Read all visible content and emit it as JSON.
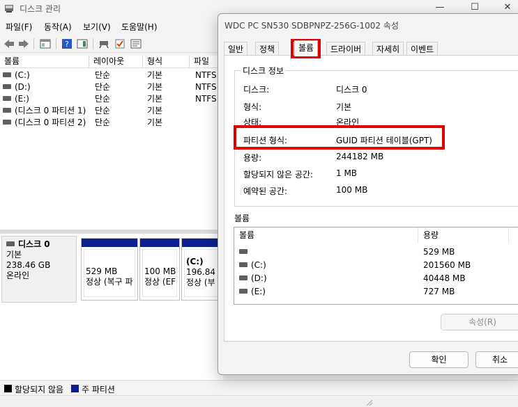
{
  "main_window": {
    "title": "디스크 관리",
    "controls": {
      "minimize": "—",
      "maximize": "☐",
      "close": "✕"
    },
    "menu": [
      "파일(F)",
      "동작(A)",
      "보기(V)",
      "도움말(H)"
    ],
    "volume_list": {
      "headers": [
        "볼륨",
        "레이아웃",
        "형식",
        "파일"
      ],
      "rows": [
        {
          "volume": "(C:)",
          "layout": "단순",
          "type": "기본",
          "fs": "NTFS"
        },
        {
          "volume": "(D:)",
          "layout": "단순",
          "type": "기본",
          "fs": "NTFS"
        },
        {
          "volume": "(E:)",
          "layout": "단순",
          "type": "기본",
          "fs": "NTFS"
        },
        {
          "volume": "(디스크 0 파티션 1)",
          "layout": "단순",
          "type": "기본",
          "fs": ""
        },
        {
          "volume": "(디스크 0 파티션 2)",
          "layout": "단순",
          "type": "기본",
          "fs": ""
        }
      ]
    },
    "disk": {
      "name": "디스크 0",
      "kind": "기본",
      "size": "238.46 GB",
      "status": "온라인",
      "partitions": [
        {
          "label": "",
          "size": "529 MB",
          "status": "정상 (복구 파"
        },
        {
          "label": "",
          "size": "100 MB",
          "status": "정상 (EF"
        },
        {
          "label": "(C:)",
          "size": "196.84 G",
          "status": "정상 (부"
        }
      ]
    },
    "legend": [
      {
        "label": "할당되지 않음",
        "color": "#000000"
      },
      {
        "label": "주 파티션",
        "color": "#0b1f8f"
      }
    ]
  },
  "dialog": {
    "title": "WDC PC SN530 SDBPNPZ-256G-1002 속성",
    "tabs": [
      "일반",
      "정책",
      "볼륨",
      "드라이버",
      "자세히",
      "이벤트"
    ],
    "active_tab": "볼륨",
    "disk_info": {
      "group_title": "디스크 정보",
      "rows": [
        {
          "label": "디스크:",
          "value": "디스크 0"
        },
        {
          "label": "형식:",
          "value": "기본"
        },
        {
          "label": "상태:",
          "value": "온라인"
        },
        {
          "label": "파티션 형식:",
          "value": "GUID 파티션 테이블(GPT)"
        },
        {
          "label": "용량:",
          "value": "244182 MB"
        },
        {
          "label": "할당되지 않은 공간:",
          "value": "1 MB"
        },
        {
          "label": "예약된 공간:",
          "value": "100 MB"
        }
      ]
    },
    "volumes": {
      "title": "볼륨",
      "headers": [
        "볼륨",
        "용량"
      ],
      "rows": [
        {
          "volume": "",
          "capacity": "529 MB"
        },
        {
          "volume": "(C:)",
          "capacity": "201560 MB"
        },
        {
          "volume": "(D:)",
          "capacity": "40448 MB"
        },
        {
          "volume": "(E:)",
          "capacity": "727 MB"
        }
      ]
    },
    "properties_button": "속성(R)",
    "ok_button": "확인",
    "cancel_button": "취소"
  },
  "colors": {
    "highlight": "#e10000",
    "primary_partition": "#0b1f8f"
  }
}
